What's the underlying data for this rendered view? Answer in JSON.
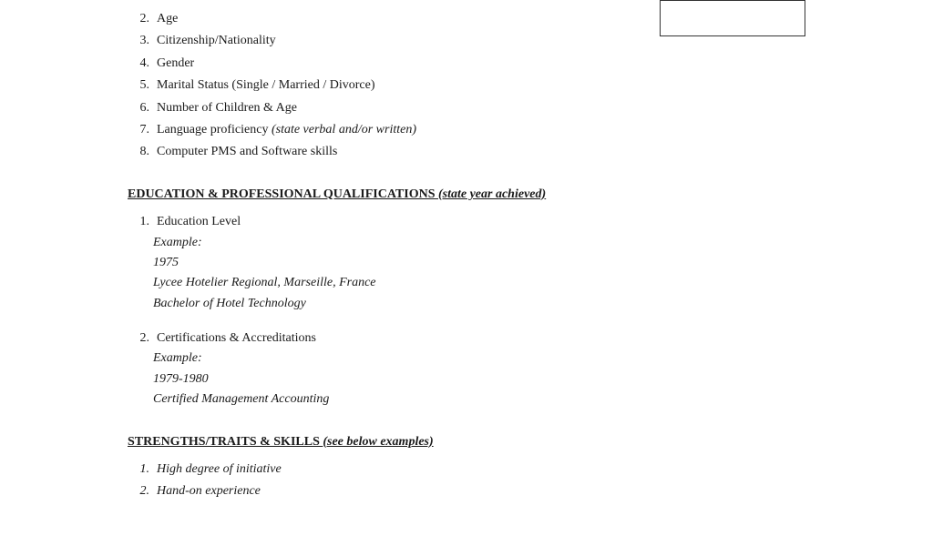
{
  "page": {
    "background": "#ffffff"
  },
  "topBox": {
    "visible": true
  },
  "personalInfo": {
    "items": [
      {
        "num": "2.",
        "text": "Age"
      },
      {
        "num": "3.",
        "text": "Citizenship/Nationality"
      },
      {
        "num": "4.",
        "text": "Gender"
      },
      {
        "num": "5.",
        "text": "Marital Status (Single / Married / Divorce)"
      },
      {
        "num": "6.",
        "text": "Number of Children & Age"
      },
      {
        "num": "7.",
        "text": "Language proficiency ",
        "italic": "(state verbal and/or written)"
      },
      {
        "num": "8.",
        "text": "Computer PMS and Software skills"
      }
    ]
  },
  "educationSection": {
    "title": "EDUCATION & PROFESSIONAL QUALIFICATIONS ",
    "titleItalic": "(state year achieved)",
    "items": [
      {
        "num": "1.",
        "label": "Education Level",
        "example": "Example:",
        "year": "1975",
        "line1": "Lycee Hotelier Regional, Marseille, France",
        "line2": "Bachelor of Hotel Technology"
      },
      {
        "num": "2.",
        "label": "Certifications & Accreditations",
        "example": "Example:",
        "year": "1979-1980",
        "line1": "Certified Management Accounting",
        "line2": ""
      }
    ]
  },
  "strengthsSection": {
    "title": "STRENGTHS/TRAITS & SKILLS ",
    "titleItalic": "(see below examples)",
    "items": [
      {
        "num": "1.",
        "text": "High degree of initiative"
      },
      {
        "num": "2.",
        "text": "Hand-on experience"
      }
    ]
  }
}
